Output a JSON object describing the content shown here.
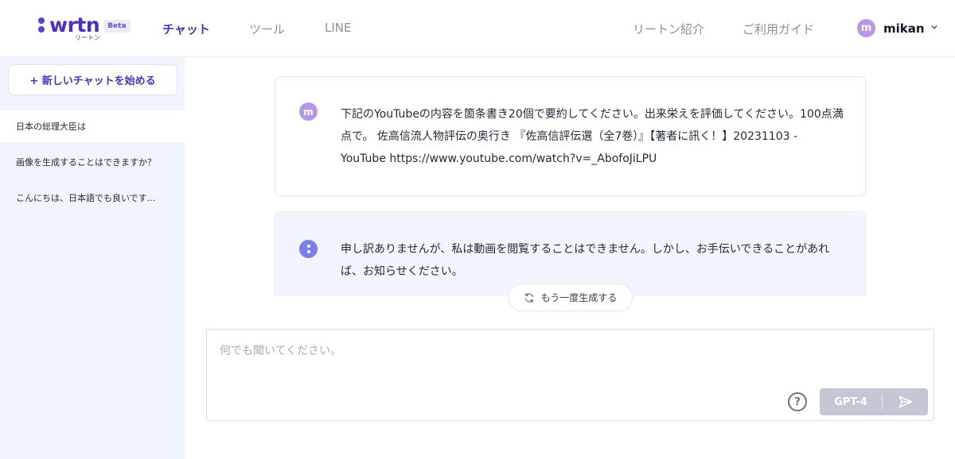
{
  "header": {
    "logo_text": "wrtn",
    "logo_sub": "リートン",
    "beta": "Beta",
    "nav": [
      "チャット",
      "ツール",
      "LINE"
    ],
    "right_links": [
      "リートン紹介",
      "ご利用ガイド"
    ],
    "user": {
      "initial": "m",
      "name": "mikan"
    }
  },
  "sidebar": {
    "new_chat_label": "+ 新しいチャットを始める",
    "history": [
      "日本の総理大臣は",
      "画像を生成することはできますか？",
      "こんにちは、日本語でも良いです..."
    ]
  },
  "chat": {
    "user_initial": "m",
    "user_message": "下記のYouTubeの内容を箇条書き20個で要約してください。出来栄えを評価してください。100点満点で。 佐高信流人物評伝の奥行き 『佐高信評伝選（全7巻）』【著者に訊く！】20231103 - YouTube https://www.youtube.com/watch?v=_AbofoJiLPU",
    "bot_message": "申し訳ありませんが、私は動画を閲覧することはできません。しかし、お手伝いできることがあれば、お知らせください。",
    "regenerate_label": "もう一度生成する"
  },
  "composer": {
    "placeholder": "何でも聞いてください。",
    "help_label": "?",
    "model_label": "GPT-4"
  },
  "colors": {
    "brand": "#4c2fc8",
    "sidebar_bg": "#f0f4fd",
    "bot_bg": "#f2f5fe",
    "avatar": "#b896e6",
    "send_disabled": "#c3c7d3"
  }
}
